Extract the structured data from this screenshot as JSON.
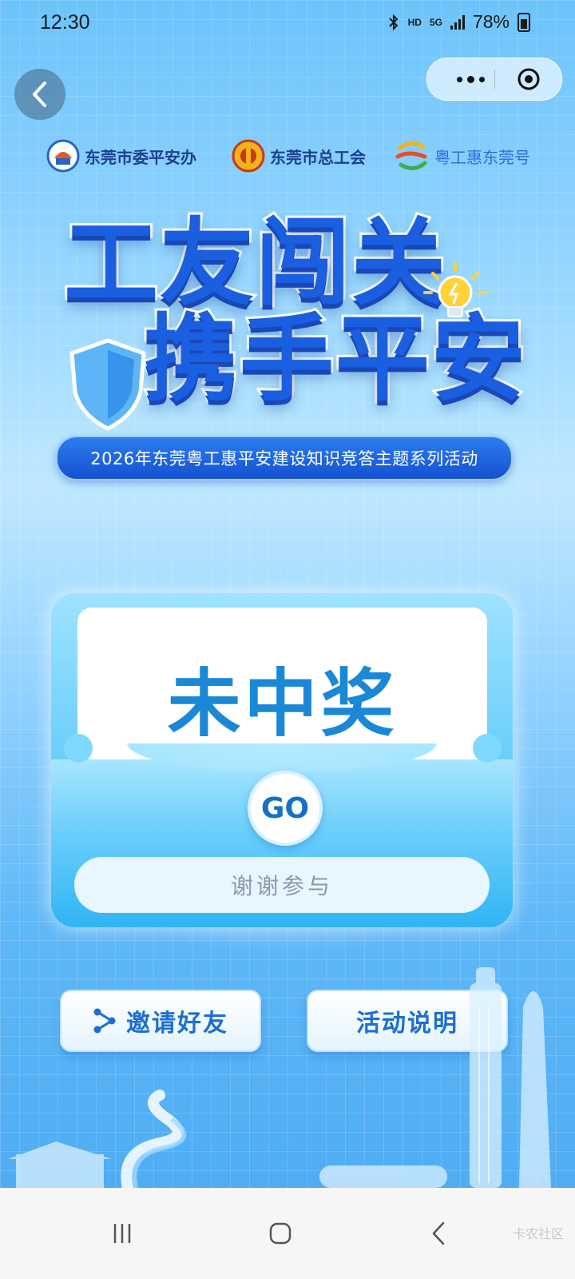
{
  "status_bar": {
    "time": "12:30",
    "bluetooth_icon": "bluetooth-icon",
    "hd_label": "HD",
    "network_label": "5G",
    "battery_percent": "78%"
  },
  "nav": {
    "back_icon": "chevron-left-icon",
    "more_icon": "more-dots-icon",
    "close_icon": "target-icon"
  },
  "logos": [
    {
      "label": "东莞市委平安办"
    },
    {
      "label": "东莞市总工会"
    },
    {
      "label": "粤工惠东莞号"
    }
  ],
  "banner": {
    "title_line1": "工友闯关",
    "title_line2": "携手平安",
    "subtitle": "2026年东莞粤工惠平安建设知识竞答主题系列活动"
  },
  "prize_card": {
    "result": "未中奖",
    "go_label": "GO",
    "message": "谢谢参与"
  },
  "actions": {
    "invite_label": "邀请好友",
    "invite_icon": "share-icon",
    "rules_label": "活动说明"
  },
  "system_nav": {
    "recents_icon": "recents-icon",
    "home_icon": "home-icon",
    "back_icon": "back-icon",
    "watermark": "卡农社区"
  },
  "colors": {
    "primary": "#1a5fe0",
    "prize_text": "#1a88d6",
    "button_text": "#1b6fd0"
  }
}
